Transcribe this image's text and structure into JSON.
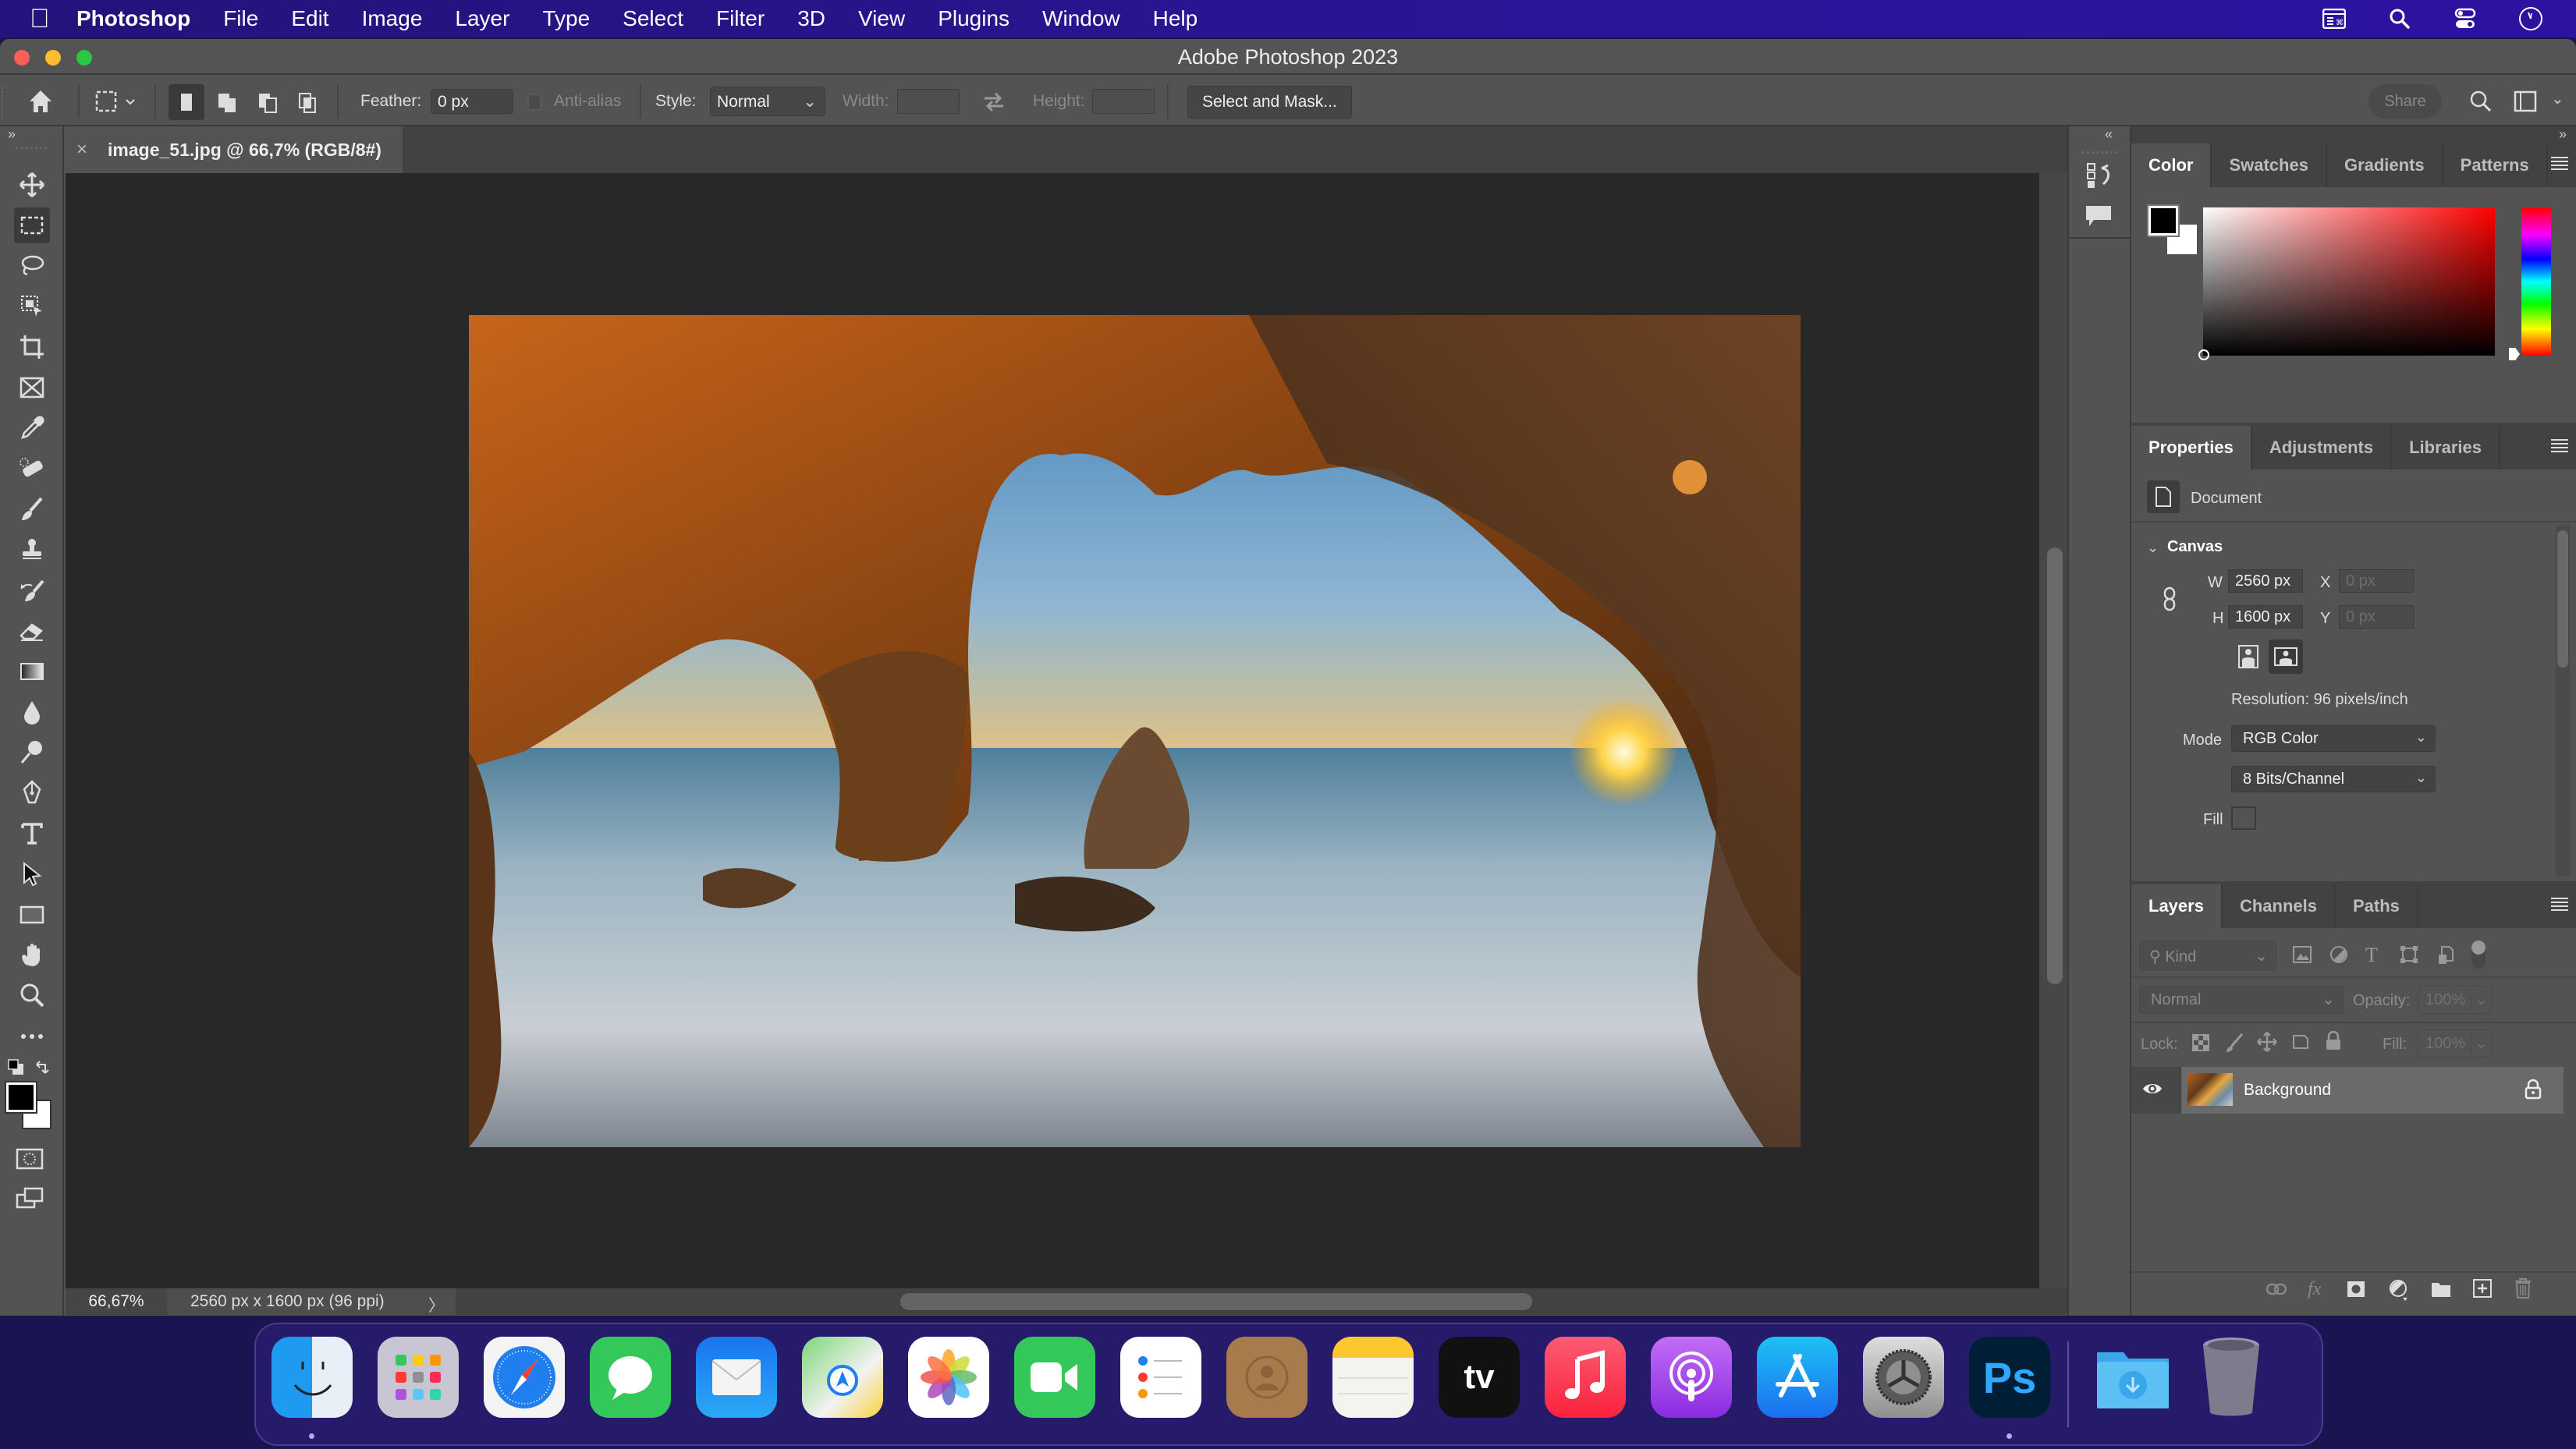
{
  "menubar": {
    "apple_icon": "apple-logo",
    "app_name": "Photoshop",
    "items": [
      "File",
      "Edit",
      "Image",
      "Layer",
      "Type",
      "Select",
      "Filter",
      "3D",
      "View",
      "Plugins",
      "Window",
      "Help"
    ],
    "status_icons": [
      "keyboard-shortcuts-icon",
      "spotlight-search-icon",
      "control-center-icon",
      "clock-icon"
    ]
  },
  "window": {
    "title": "Adobe Photoshop 2023"
  },
  "options_bar": {
    "feather_label": "Feather:",
    "feather_value": "0 px",
    "anti_alias_label": "Anti-alias",
    "style_label": "Style:",
    "style_value": "Normal",
    "width_label": "Width:",
    "width_value": "",
    "height_label": "Height:",
    "height_value": "",
    "select_mask_label": "Select and Mask...",
    "share_label": "Share"
  },
  "document_tab": {
    "close": "×",
    "title": "image_51.jpg @ 66,7% (RGB/8#)"
  },
  "tools": [
    "move",
    "rectangular-marquee",
    "lasso",
    "object-selection",
    "crop",
    "frame",
    "eyedropper",
    "spot-healing",
    "brush",
    "clone-stamp",
    "history-brush",
    "eraser",
    "gradient",
    "blur",
    "dodge",
    "pen",
    "type",
    "path-selection",
    "rectangle",
    "hand",
    "zoom",
    "edit-toolbar"
  ],
  "selected_tool": "rectangular-marquee",
  "foreground_color": "#000000",
  "background_color": "#ffffff",
  "status_bar": {
    "zoom": "66,67%",
    "doc_info": "2560 px x 1600 px (96 ppi)",
    "arrow": "〉"
  },
  "color_panel": {
    "tabs": [
      "Color",
      "Swatches",
      "Gradients",
      "Patterns"
    ],
    "active_tab": "Color",
    "hue": "#ff0000"
  },
  "properties_panel": {
    "tabs": [
      "Properties",
      "Adjustments",
      "Libraries"
    ],
    "active_tab": "Properties",
    "doc_label": "Document",
    "section": "Canvas",
    "w_label": "W",
    "w_value": "2560 px",
    "h_label": "H",
    "h_value": "1600 px",
    "x_label": "X",
    "x_value": "0 px",
    "y_label": "Y",
    "y_value": "0 px",
    "resolution": "Resolution: 96 pixels/inch",
    "mode_label": "Mode",
    "mode_value": "RGB Color",
    "bits_value": "8 Bits/Channel",
    "fill_label": "Fill"
  },
  "layers_panel": {
    "tabs": [
      "Layers",
      "Channels",
      "Paths"
    ],
    "active_tab": "Layers",
    "filter_placeholder": "Kind",
    "blend_mode": "Normal",
    "opacity_label": "Opacity:",
    "opacity_value": "100%",
    "lock_label": "Lock:",
    "fill_label": "Fill:",
    "fill_value": "100%",
    "layers": [
      {
        "name": "Background",
        "visible": true,
        "locked": true
      }
    ]
  },
  "dock": {
    "apps": [
      "Finder",
      "Launchpad",
      "Safari",
      "Messages",
      "Mail",
      "Maps",
      "Photos",
      "FaceTime",
      "Reminders",
      "Contacts",
      "Notes",
      "TV",
      "Music",
      "Podcasts",
      "App Store",
      "System Settings",
      "Photoshop"
    ],
    "running": [
      "Finder",
      "Photoshop"
    ],
    "others": [
      "Downloads",
      "Trash"
    ],
    "ps_text": "Ps",
    "tv_text": "tv"
  }
}
